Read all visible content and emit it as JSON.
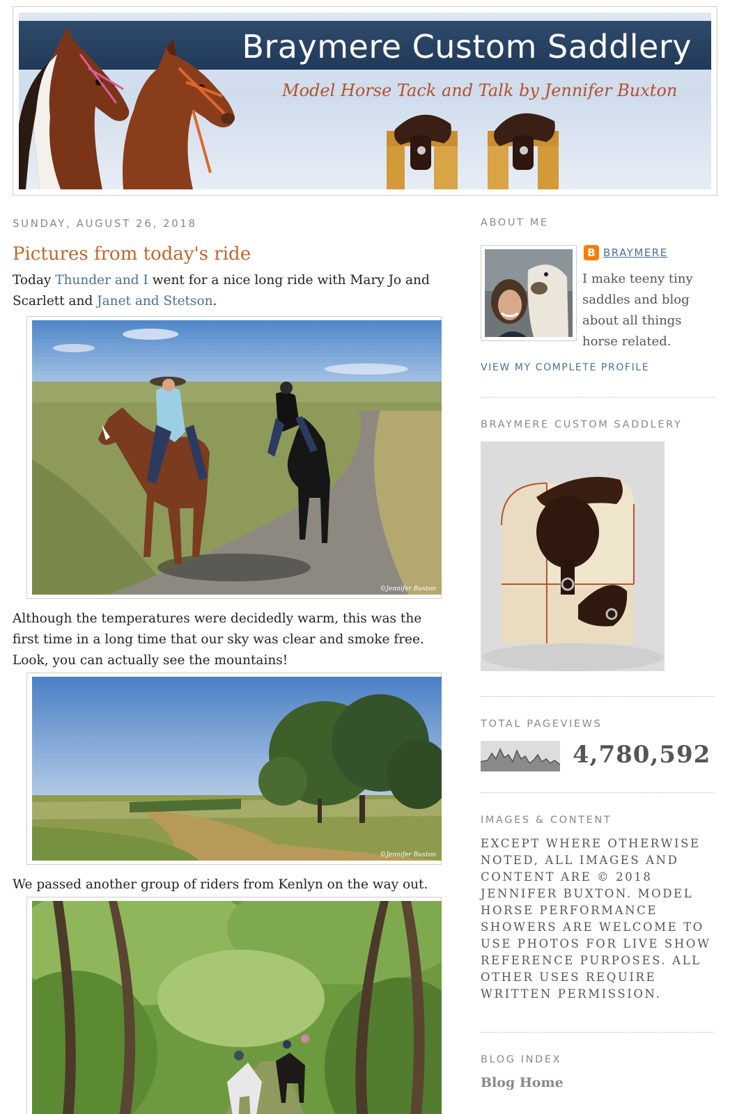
{
  "header": {
    "title": "Braymere Custom Saddlery",
    "subtitle": "Model Horse Tack and Talk by Jennifer Buxton"
  },
  "post": {
    "date": "SUNDAY, AUGUST 26, 2018",
    "title": "Pictures from today's ride",
    "p1_before": "Today ",
    "p1_link1": "Thunder and I",
    "p1_middle": " went for a nice long ride with Mary Jo and Scarlett and ",
    "p1_link2": "Janet and Stetson",
    "p1_after": ".",
    "p2": "Although the temperatures were decidedly warm, this was the first time in a long time that our sky was clear and smoke free. Look, you can actually see the mountains!",
    "p3": "We passed another group of riders from Kenlyn on the way out.",
    "watermark": "©Jennifer Buxton"
  },
  "sidebar": {
    "about_heading": "ABOUT ME",
    "profile_name": "BRAYMERE",
    "profile_desc": "I make teeny tiny saddles and blog about all things horse related.",
    "view_profile": "VIEW MY COMPLETE PROFILE",
    "saddlery_heading": "BRAYMERE CUSTOM SADDLERY",
    "pageviews_heading": "TOTAL PAGEVIEWS",
    "pageviews_count": "4,780,592",
    "images_heading": "IMAGES & CONTENT",
    "images_notice": "EXCEPT WHERE OTHERWISE NOTED, ALL IMAGES AND CONTENT ARE © 2018 JENNIFER BUXTON. MODEL HORSE PERFORMANCE SHOWERS ARE WELCOME TO USE PHOTOS FOR LIVE SHOW REFERENCE PURPOSES. ALL OTHER USES REQUIRE WRITTEN PERMISSION.",
    "blog_index_heading": "BLOG INDEX",
    "blog_home": "Blog Home"
  },
  "colors": {
    "link": "#4a6f9a",
    "post_title": "#c0672b",
    "banner_bar": "#2a4466",
    "banner_subtitle": "#b4502c",
    "blogger_orange": "#f57d00"
  }
}
